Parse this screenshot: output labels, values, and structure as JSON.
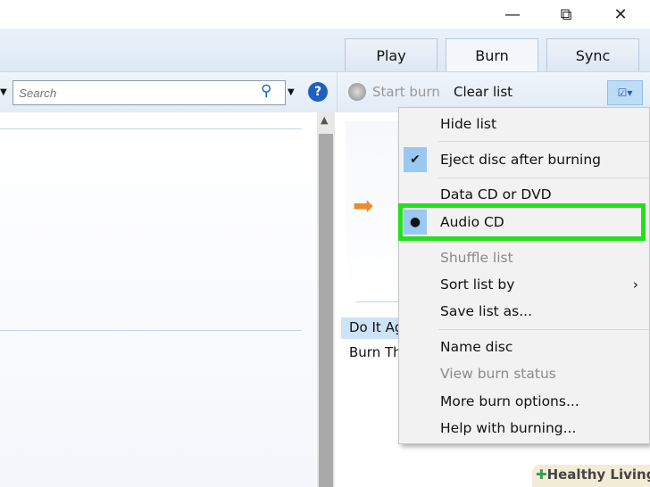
{
  "window": {
    "minimize": "—",
    "restore": "⧉",
    "close": "✕"
  },
  "tabs": [
    {
      "label": "Play"
    },
    {
      "label": "Burn"
    },
    {
      "label": "Sync"
    }
  ],
  "toolbar": {
    "search_placeholder": "Search",
    "start_burn": "Start burn",
    "clear_list": "Clear list"
  },
  "burn_list": {
    "items": [
      "Do It Ag",
      "Burn Th"
    ]
  },
  "menu": {
    "items": [
      {
        "label": "Hide list"
      },
      {
        "label": "Eject disc after burning",
        "checked": true
      },
      {
        "label": "Data CD or DVD"
      },
      {
        "label": "Audio CD",
        "selected": true
      },
      {
        "label": "Shuffle list",
        "disabled": true
      },
      {
        "label": "Sort list by",
        "submenu": true
      },
      {
        "label": "Save list as..."
      },
      {
        "label": "Name disc"
      },
      {
        "label": "View burn status",
        "disabled": true
      },
      {
        "label": "More burn options..."
      },
      {
        "label": "Help with burning..."
      }
    ]
  },
  "watermark": "Healthy Living",
  "colors": {
    "highlight": "#22e01a",
    "check_bg": "#99c8f2"
  }
}
